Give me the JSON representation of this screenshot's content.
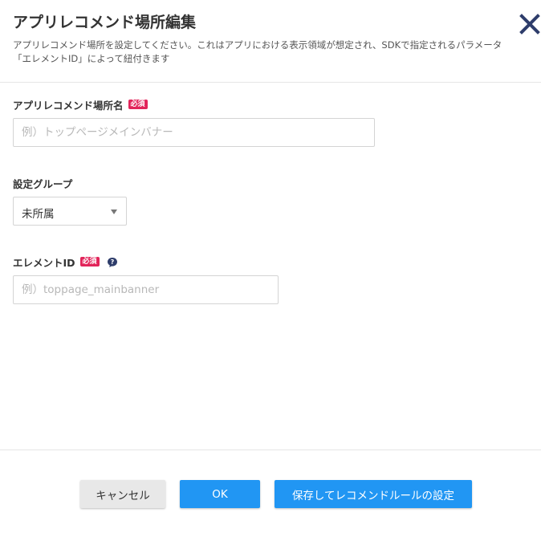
{
  "dialog": {
    "title": "アプリレコメンド場所編集",
    "description_line1": "アプリレコメンド場所を設定してください。これはアプリにおける表示領域が想定され、SDKで指定されるパラメータ",
    "description_line2": "「エレメントID」によって紐付きます",
    "close_icon": "close-x-icon"
  },
  "form": {
    "place_name": {
      "label": "アプリレコメンド場所名",
      "required_badge": "必須",
      "value": "",
      "placeholder": "例）トップページメインバナー"
    },
    "group": {
      "label": "設定グループ",
      "selected": "未所属"
    },
    "element_id": {
      "label": "エレメントID",
      "required_badge": "必須",
      "help_icon": "question-circle-icon",
      "value": "",
      "placeholder": "例）toppage_mainbanner"
    }
  },
  "footer": {
    "cancel_label": "キャンセル",
    "ok_label": "OK",
    "save_rule_label": "保存してレコメンドルールの設定"
  },
  "colors": {
    "primary_button": "#2196f3",
    "required_badge": "#e2245a",
    "close_icon": "#2e3d6b",
    "help_icon": "#2e3d6b"
  }
}
